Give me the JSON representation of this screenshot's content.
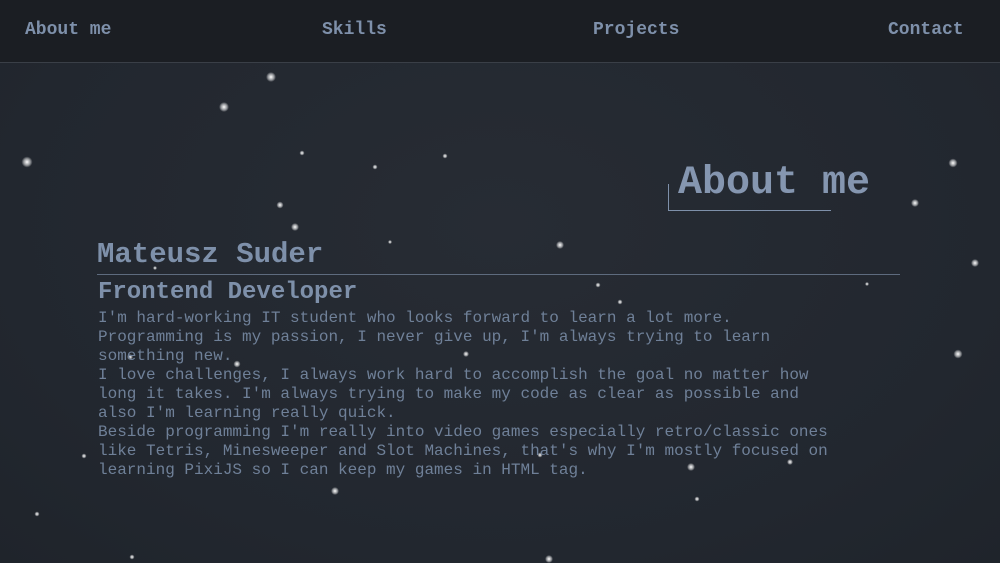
{
  "nav": {
    "items": [
      {
        "label": "About me"
      },
      {
        "label": "Skills"
      },
      {
        "label": "Projects"
      },
      {
        "label": "Contact"
      }
    ]
  },
  "about": {
    "section_title": "About me",
    "name": "Mateusz Suder",
    "role": "Frontend Developer",
    "bio_lines": [
      "I'm hard-working IT student who looks forward to learn a lot more.",
      "Programming is my passion, I never give up, I'm always trying to learn",
      "something new.",
      "I love challenges, I always work hard to accomplish the goal no matter how",
      "long it takes. I'm always trying to make my code as clear as possible and",
      "also I'm learning really quick.",
      "Beside programming I'm really into video games especially retro/classic ones",
      "like Tetris, Minesweeper and Slot Machines, that's why I'm mostly focused on",
      "learning PixiJS so I can keep my games in HTML tag."
    ]
  },
  "colors": {
    "background": "#232830",
    "navbar": "#1b1e23",
    "text": "#7e90aa",
    "star": "#ffffff"
  }
}
